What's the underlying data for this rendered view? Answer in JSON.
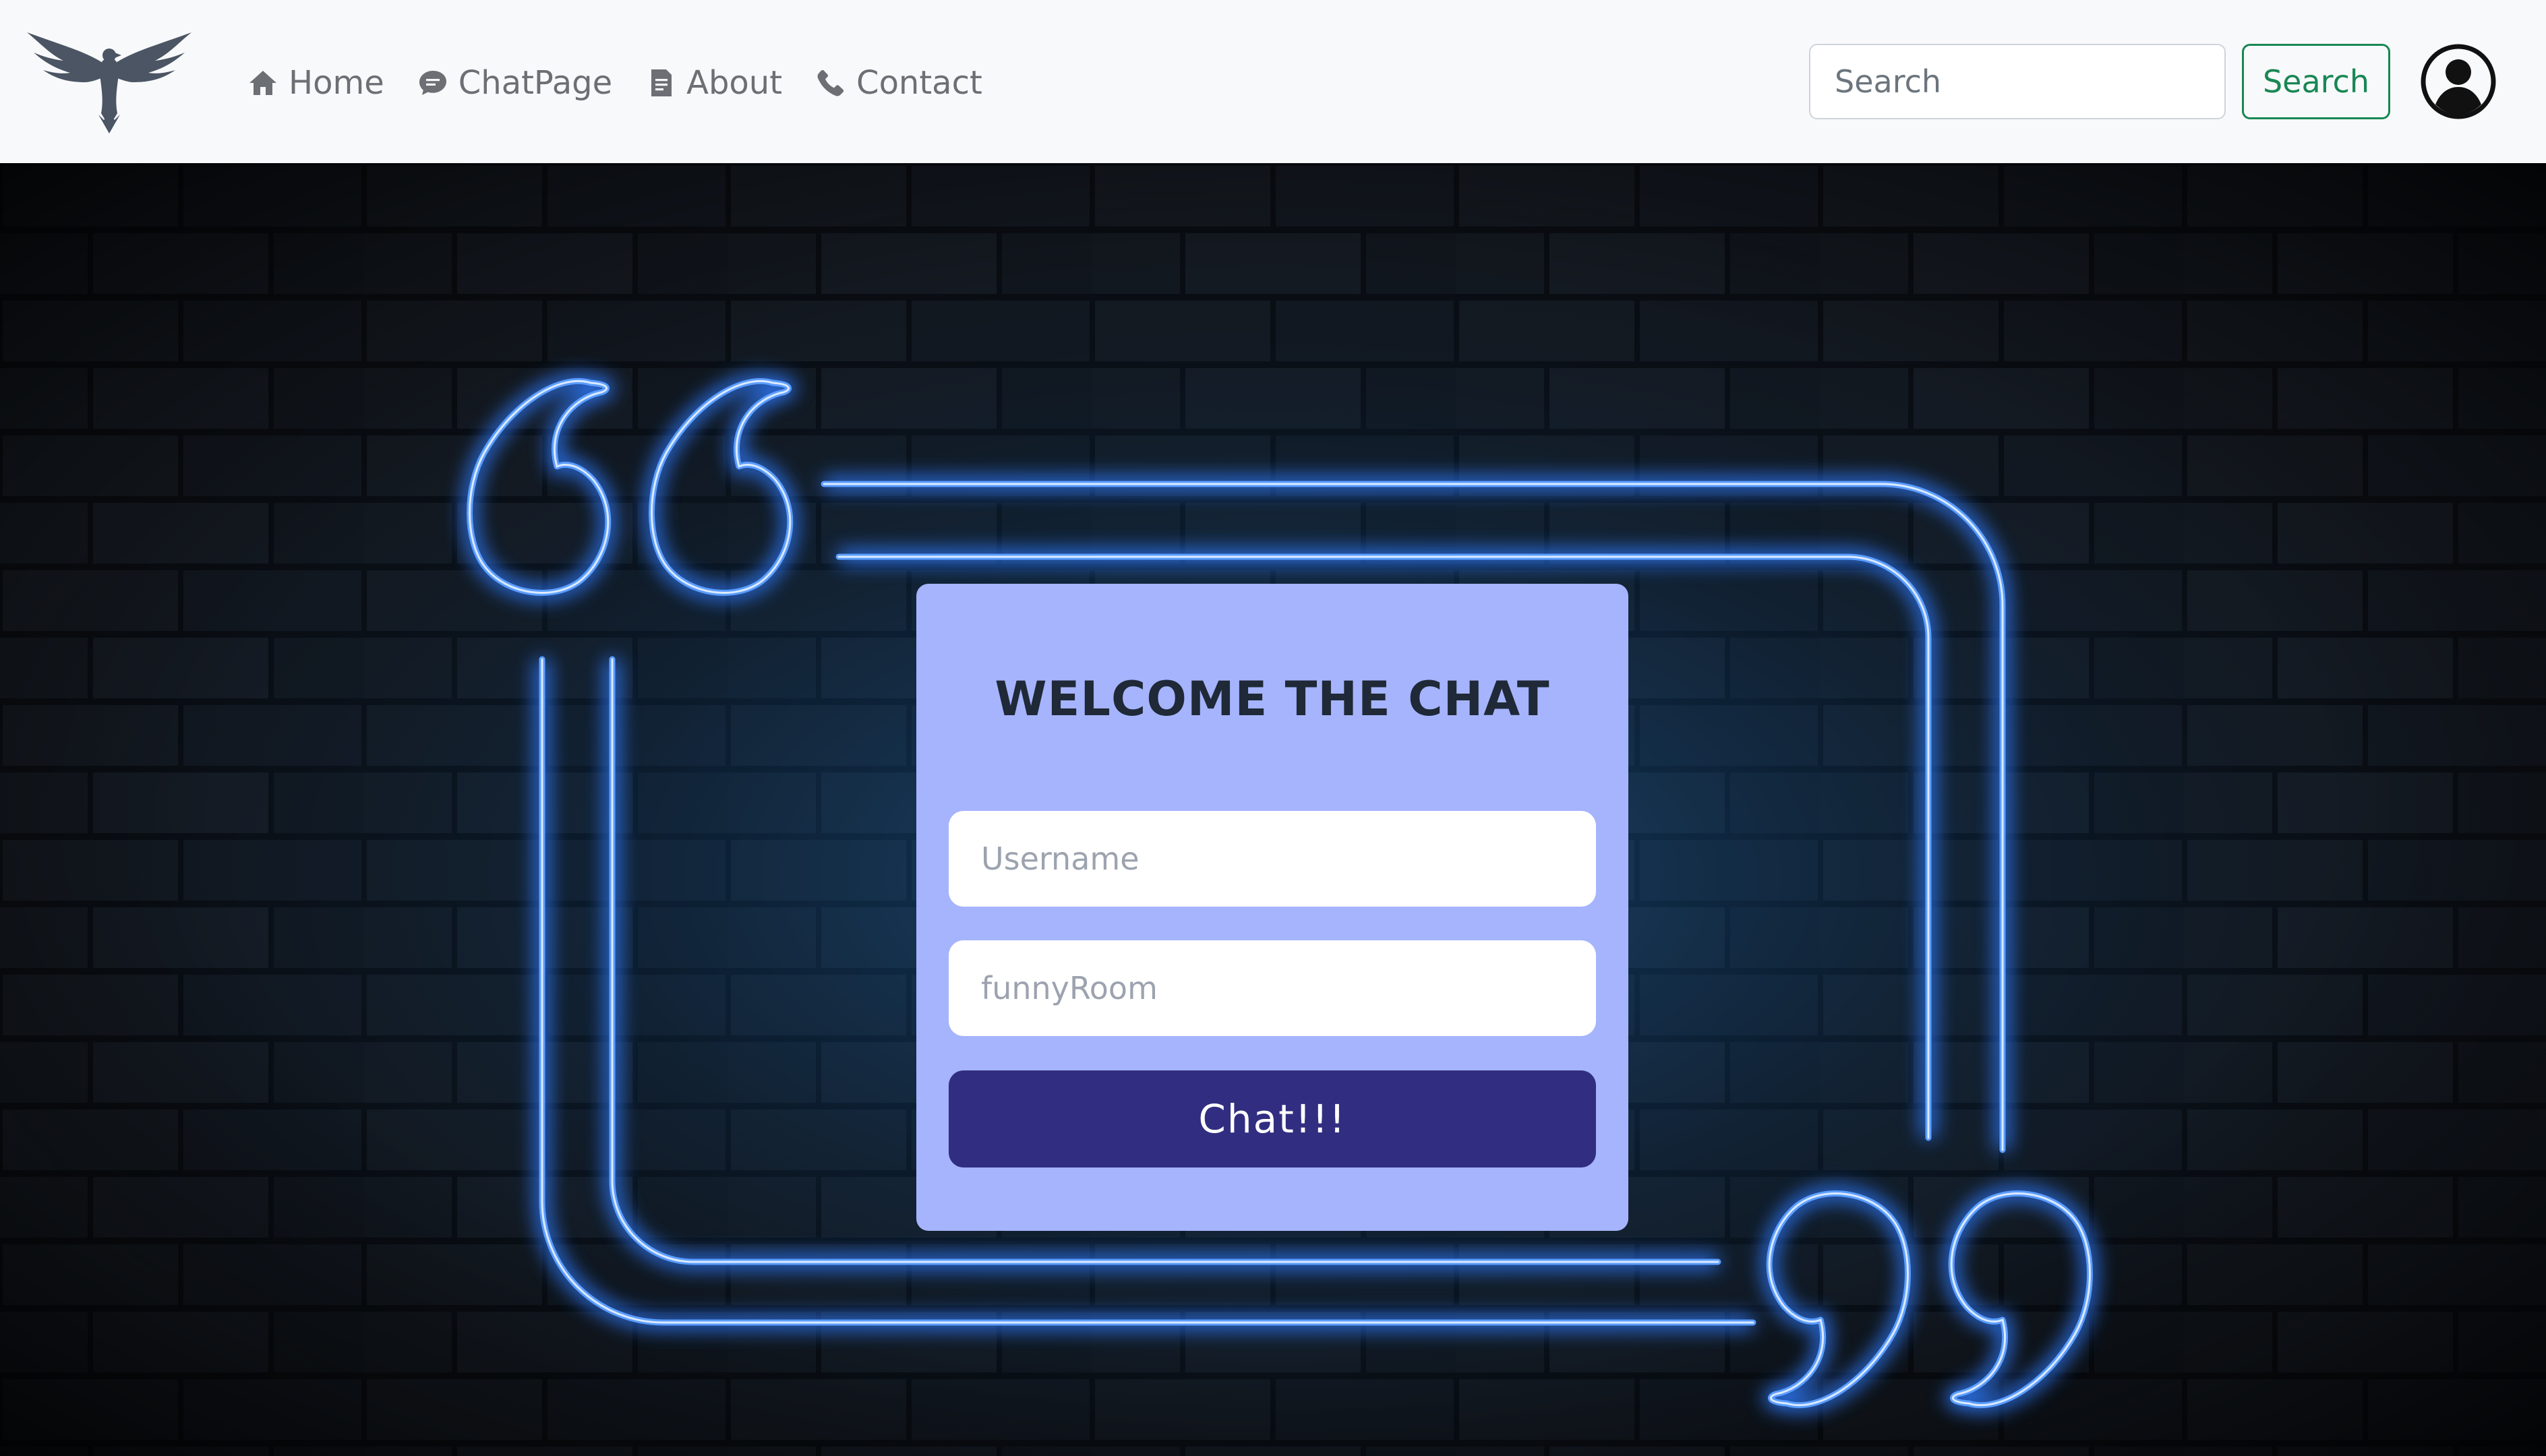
{
  "navbar": {
    "logo_icon": "eagle-logo-icon",
    "links": [
      {
        "label": "Home",
        "icon": "home-icon"
      },
      {
        "label": "ChatPage",
        "icon": "chat-bubble-icon"
      },
      {
        "label": "About",
        "icon": "document-icon"
      },
      {
        "label": "Contact",
        "icon": "phone-icon"
      }
    ],
    "search_placeholder": "Search",
    "search_button": "Search",
    "avatar_icon": "user-circle-icon"
  },
  "chat_form": {
    "title": "WELCOME THE CHAT",
    "username_placeholder": "Username",
    "room_placeholder": "funnyRoom",
    "submit_label": "Chat!!!"
  },
  "colors": {
    "navbar_bg": "#f8f9fa",
    "search_accent": "#198754",
    "card_bg": "#a5b4fc",
    "button_bg": "#312e81",
    "neon": "#3b82f6"
  }
}
